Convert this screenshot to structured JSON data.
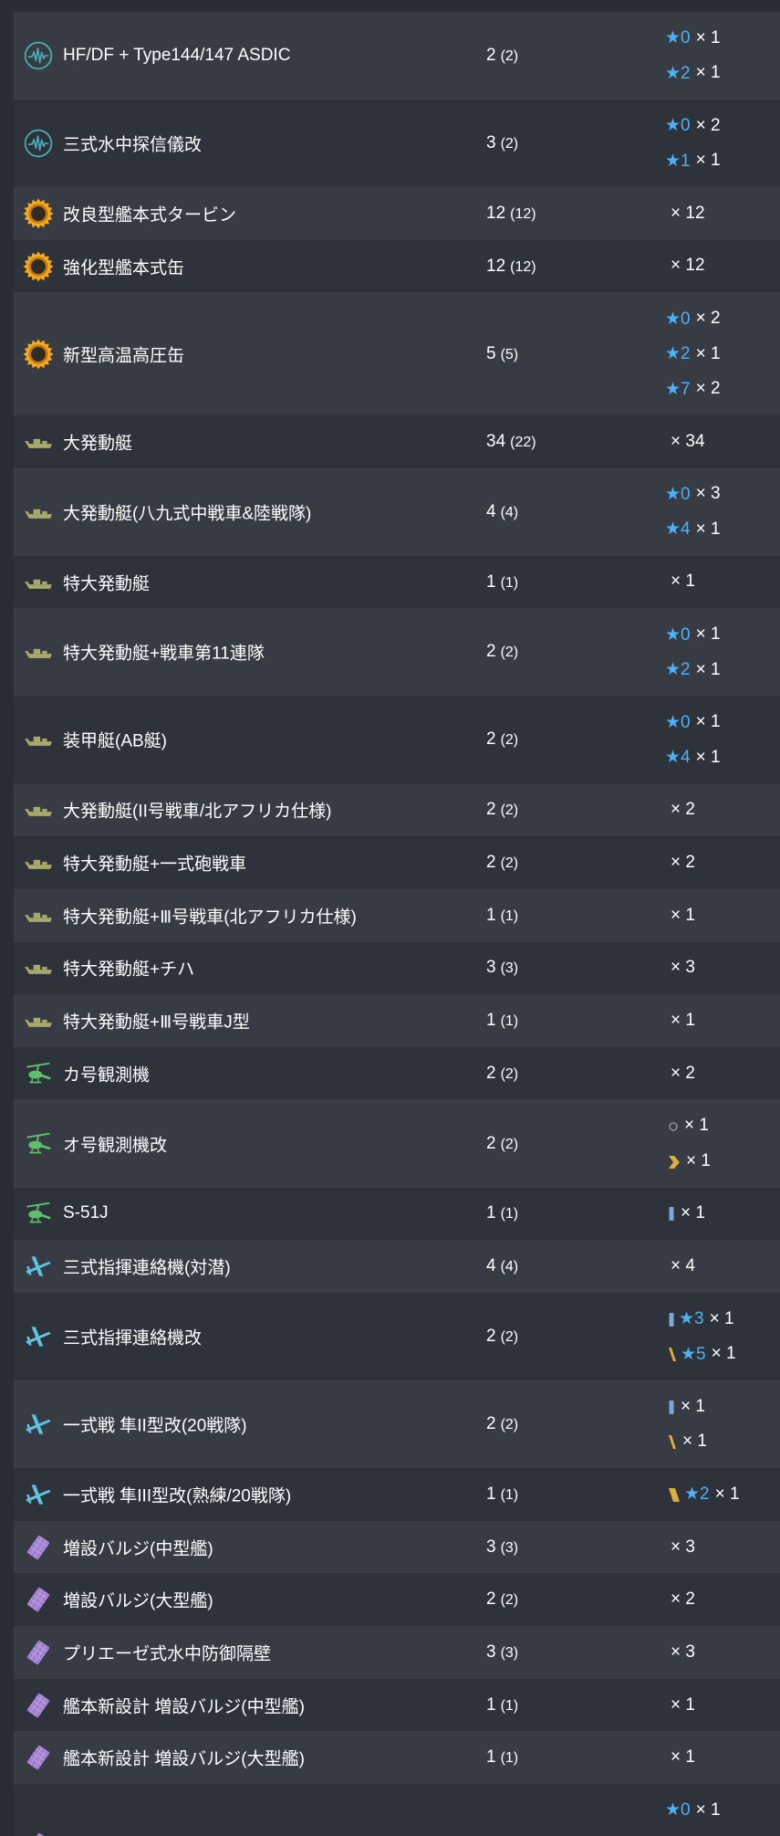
{
  "colors": {
    "page": "#292d34",
    "row_light": "#373b43",
    "row_dark": "#2e323a",
    "star": "#4eb1f3",
    "sonar": "#4fadb4",
    "boiler": "#f3a81f",
    "landing": "#a7a96a",
    "autogyro": "#5fbf6c",
    "liaison": "#5ec3de",
    "bulge": "#a07fcf",
    "prof_blue": "#7fa6d6",
    "prof_gold": "#dcae3a",
    "prof_circle": "#9aa0a8"
  },
  "rows": [
    {
      "icon": "sonar-icon",
      "name": "HF/DF + Type144/147 ASDIC",
      "count": "2",
      "total": "(2)",
      "details": [
        {
          "star": "★0",
          "qty": "× 1"
        },
        {
          "star": "★2",
          "qty": "× 1"
        }
      ]
    },
    {
      "icon": "sonar-icon",
      "name": "三式水中探信儀改",
      "count": "3",
      "total": "(2)",
      "details": [
        {
          "star": "★0",
          "qty": "× 2"
        },
        {
          "star": "★1",
          "qty": "× 1"
        }
      ]
    },
    {
      "icon": "boiler-icon",
      "name": "改良型艦本式タービン",
      "count": "12",
      "total": "(12)",
      "details": [
        {
          "qty": "× 12"
        }
      ]
    },
    {
      "icon": "boiler-icon",
      "name": "強化型艦本式缶",
      "count": "12",
      "total": "(12)",
      "details": [
        {
          "qty": "× 12"
        }
      ]
    },
    {
      "icon": "boiler-icon",
      "name": "新型高温高圧缶",
      "count": "5",
      "total": "(5)",
      "details": [
        {
          "star": "★0",
          "qty": "× 2"
        },
        {
          "star": "★2",
          "qty": "× 1"
        },
        {
          "star": "★7",
          "qty": "× 2"
        }
      ]
    },
    {
      "icon": "landing-craft-icon",
      "name": "大発動艇",
      "count": "34",
      "total": "(22)",
      "details": [
        {
          "qty": "× 34"
        }
      ]
    },
    {
      "icon": "landing-craft-icon",
      "name": "大発動艇(八九式中戦車&陸戦隊)",
      "count": "4",
      "total": "(4)",
      "details": [
        {
          "star": "★0",
          "qty": "× 3"
        },
        {
          "star": "★4",
          "qty": "× 1"
        }
      ]
    },
    {
      "icon": "landing-craft-icon",
      "name": "特大発動艇",
      "count": "1",
      "total": "(1)",
      "details": [
        {
          "qty": "× 1"
        }
      ]
    },
    {
      "icon": "landing-craft-icon",
      "name": "特大発動艇+戦車第11連隊",
      "count": "2",
      "total": "(2)",
      "details": [
        {
          "star": "★0",
          "qty": "× 1"
        },
        {
          "star": "★2",
          "qty": "× 1"
        }
      ]
    },
    {
      "icon": "landing-craft-icon",
      "name": "装甲艇(AB艇)",
      "count": "2",
      "total": "(2)",
      "details": [
        {
          "star": "★0",
          "qty": "× 1"
        },
        {
          "star": "★4",
          "qty": "× 1"
        }
      ]
    },
    {
      "icon": "landing-craft-icon",
      "name": "大発動艇(II号戦車/北アフリカ仕様)",
      "count": "2",
      "total": "(2)",
      "details": [
        {
          "qty": "× 2"
        }
      ]
    },
    {
      "icon": "landing-craft-icon",
      "name": "特大発動艇+一式砲戦車",
      "count": "2",
      "total": "(2)",
      "details": [
        {
          "qty": "× 2"
        }
      ]
    },
    {
      "icon": "landing-craft-icon",
      "name": "特大発動艇+Ⅲ号戦車(北アフリカ仕様)",
      "count": "1",
      "total": "(1)",
      "details": [
        {
          "qty": "× 1"
        }
      ]
    },
    {
      "icon": "landing-craft-icon",
      "name": "特大発動艇+チハ",
      "count": "3",
      "total": "(3)",
      "details": [
        {
          "qty": "× 3"
        }
      ]
    },
    {
      "icon": "landing-craft-icon",
      "name": "特大発動艇+Ⅲ号戦車J型",
      "count": "1",
      "total": "(1)",
      "details": [
        {
          "qty": "× 1"
        }
      ]
    },
    {
      "icon": "autogyro-icon",
      "name": "カ号観測機",
      "count": "2",
      "total": "(2)",
      "details": [
        {
          "qty": "× 2"
        }
      ]
    },
    {
      "icon": "autogyro-icon",
      "name": "オ号観測機改",
      "count": "2",
      "total": "(2)",
      "details": [
        {
          "prof": "proficiency-circle-icon",
          "qty": "× 1"
        },
        {
          "prof": "proficiency-chevron-icon",
          "qty": "× 1"
        }
      ]
    },
    {
      "icon": "autogyro-icon",
      "name": "S-51J",
      "count": "1",
      "total": "(1)",
      "details": [
        {
          "prof": "proficiency-blue-bar-icon",
          "qty": "× 1"
        }
      ]
    },
    {
      "icon": "liaison-plane-icon",
      "name": "三式指揮連絡機(対潜)",
      "count": "4",
      "total": "(4)",
      "details": [
        {
          "qty": "× 4"
        }
      ]
    },
    {
      "icon": "liaison-plane-icon",
      "name": "三式指揮連絡機改",
      "count": "2",
      "total": "(2)",
      "details": [
        {
          "prof": "proficiency-blue-bar-icon",
          "star": "★3",
          "qty": "× 1"
        },
        {
          "prof": "proficiency-gold-slash-icon",
          "star": "★5",
          "qty": "× 1"
        }
      ]
    },
    {
      "icon": "liaison-plane-icon",
      "name": "一式戦 隼II型改(20戦隊)",
      "count": "2",
      "total": "(2)",
      "details": [
        {
          "prof": "proficiency-blue-bar-icon",
          "qty": "× 1"
        },
        {
          "prof": "proficiency-gold-slash-icon",
          "qty": "× 1"
        }
      ]
    },
    {
      "icon": "liaison-plane-icon",
      "name": "一式戦 隼III型改(熟練/20戦隊)",
      "count": "1",
      "total": "(1)",
      "details": [
        {
          "prof": "proficiency-gold-block-icon",
          "star": "★2",
          "qty": "× 1"
        }
      ]
    },
    {
      "icon": "bulge-icon",
      "name": "増設バルジ(中型艦)",
      "count": "3",
      "total": "(3)",
      "details": [
        {
          "qty": "× 3"
        }
      ]
    },
    {
      "icon": "bulge-icon",
      "name": "増設バルジ(大型艦)",
      "count": "2",
      "total": "(2)",
      "details": [
        {
          "qty": "× 2"
        }
      ]
    },
    {
      "icon": "bulge-icon",
      "name": "プリエーゼ式水中防御隔壁",
      "count": "3",
      "total": "(3)",
      "details": [
        {
          "qty": "× 3"
        }
      ]
    },
    {
      "icon": "bulge-icon",
      "name": "艦本新設計 増設バルジ(中型艦)",
      "count": "1",
      "total": "(1)",
      "details": [
        {
          "qty": "× 1"
        }
      ]
    },
    {
      "icon": "bulge-icon",
      "name": "艦本新設計 増設バルジ(大型艦)",
      "count": "1",
      "total": "(1)",
      "details": [
        {
          "qty": "× 1"
        }
      ]
    },
    {
      "icon": "bulge-icon",
      "details": [
        {
          "star": "★0",
          "qty": "× 1"
        }
      ]
    }
  ]
}
